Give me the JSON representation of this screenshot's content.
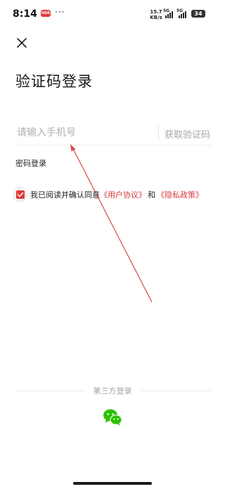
{
  "status_bar": {
    "time": "8:14",
    "app_badge": "HDR",
    "more_dots": "···",
    "net_speed_value": "15.7",
    "net_speed_unit": "KB/s",
    "signal_1_label": "5G",
    "signal_2_label": "5G",
    "battery": "34"
  },
  "page": {
    "title": "验证码登录"
  },
  "phone": {
    "placeholder": "请输入手机号",
    "value": "",
    "get_code_label": "获取验证码"
  },
  "password_login_label": "密码登录",
  "agreement": {
    "checked": true,
    "prefix": "我已阅读并确认同意",
    "user_agreement": "《用户协议》",
    "conjunction": "和",
    "privacy_policy": "《隐私政策》",
    "link_color": "#d63a3a"
  },
  "third_party": {
    "label": "第三方登录",
    "providers": [
      "wechat-icon"
    ]
  },
  "colors": {
    "accent": "#e03c3c",
    "annotation": "#d94a4a",
    "placeholder": "#b0b0b0"
  }
}
